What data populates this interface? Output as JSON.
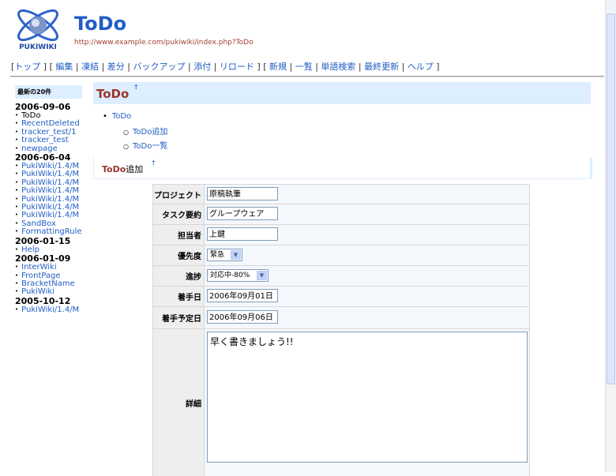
{
  "header": {
    "title": "ToDo",
    "url": "http://www.example.com/pukiwiki/index.php?ToDo",
    "logo_text": "PUKIWIKI"
  },
  "menu": {
    "group1": [
      "トップ"
    ],
    "group2": [
      "編集",
      "凍結",
      "差分",
      "バックアップ",
      "添付",
      "リロード"
    ],
    "group3": [
      "新規",
      "一覧",
      "単語検索",
      "最終更新",
      "ヘルプ"
    ]
  },
  "sidebar": {
    "heading": "最新の20件",
    "dates": [
      {
        "date": "2006-09-06",
        "items": [
          {
            "label": "ToDo",
            "current": true
          },
          {
            "label": "RecentDeleted"
          },
          {
            "label": "tracker_test/1"
          },
          {
            "label": "tracker_test"
          },
          {
            "label": "newpage"
          }
        ]
      },
      {
        "date": "2006-06-04",
        "items": [
          {
            "label": "PukiWiki/1.4/M"
          },
          {
            "label": "PukiWiki/1.4/M"
          },
          {
            "label": "PukiWiki/1.4/M"
          },
          {
            "label": "PukiWiki/1.4/M"
          },
          {
            "label": "PukiWiki/1.4/M"
          },
          {
            "label": "PukiWiki/1.4/M"
          },
          {
            "label": "PukiWiki/1.4/M"
          },
          {
            "label": "SandBox"
          },
          {
            "label": "FormattingRule"
          }
        ]
      },
      {
        "date": "2006-01-15",
        "items": [
          {
            "label": "Help"
          }
        ]
      },
      {
        "date": "2006-01-09",
        "items": [
          {
            "label": "InterWiki"
          },
          {
            "label": "FrontPage"
          },
          {
            "label": "BracketName"
          },
          {
            "label": "PukiWiki"
          }
        ]
      },
      {
        "date": "2005-10-12",
        "items": [
          {
            "label": "PukiWiki/1.4/M"
          }
        ]
      }
    ]
  },
  "main": {
    "h2": "ToDo",
    "dagger": "†",
    "toc": {
      "top": "ToDo",
      "children": [
        "ToDo追加",
        "ToDo一覧"
      ]
    },
    "h3_strong": "ToDo",
    "h3_rest": "追加"
  },
  "form": {
    "project_label": "プロジェクト",
    "project_value": "原稿執筆",
    "task_label": "タスク要約",
    "task_value": "グループウェア",
    "owner_label": "担当者",
    "owner_value": "上鍵",
    "priority_label": "優先度",
    "priority_value": "緊急",
    "progress_label": "進捗",
    "progress_value": "対応中-80%",
    "start_label": "着手日",
    "start_value": "2006年09月01日",
    "plan_label": "着手予定日",
    "plan_value": "2006年09月06日",
    "detail_label": "詳細",
    "detail_value": "早く書きましょう!!"
  },
  "colors": {
    "link": "#215dc6",
    "heading": "#99352b",
    "header_bg": "#ddeeff"
  }
}
